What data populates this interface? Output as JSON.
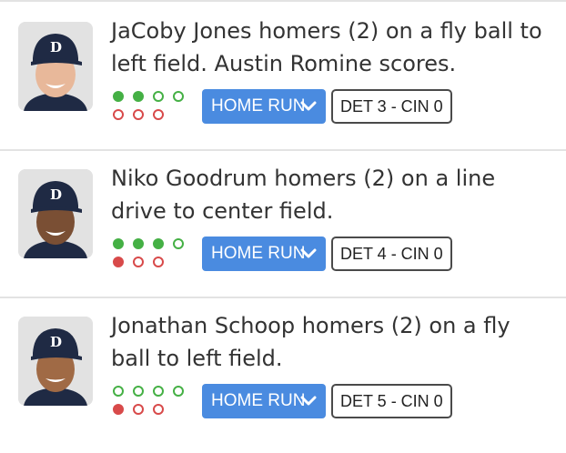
{
  "plays": [
    {
      "description": "JaCoby Jones homers (2) on a fly ball to left field. Austin Romine scores.",
      "balls": 2,
      "outs": 0,
      "result_label": "HOME RUN",
      "score": "DET 3 - CIN 0",
      "team_logo": "D"
    },
    {
      "description": "Niko Goodrum homers (2) on a line drive to center field.",
      "balls": 3,
      "outs": 1,
      "result_label": "HOME RUN",
      "score": "DET 4 - CIN 0",
      "team_logo": "D"
    },
    {
      "description": "Jonathan Schoop homers (2) on a fly ball to left field.",
      "balls": 0,
      "outs": 1,
      "result_label": "HOME RUN",
      "score": "DET 5 - CIN 0",
      "team_logo": "D"
    }
  ],
  "icons": {
    "result_dropdown": "chevron-down-icon",
    "avatar": "player-headshot",
    "ball_indicator": "ball-count-dot",
    "out_indicator": "out-count-dot"
  },
  "colors": {
    "button_bg": "#4a8be0",
    "ball": "#45b045",
    "out": "#d84a4a",
    "cap": "#1f2a44",
    "score_border": "#4a4a4a",
    "text": "#333333"
  }
}
